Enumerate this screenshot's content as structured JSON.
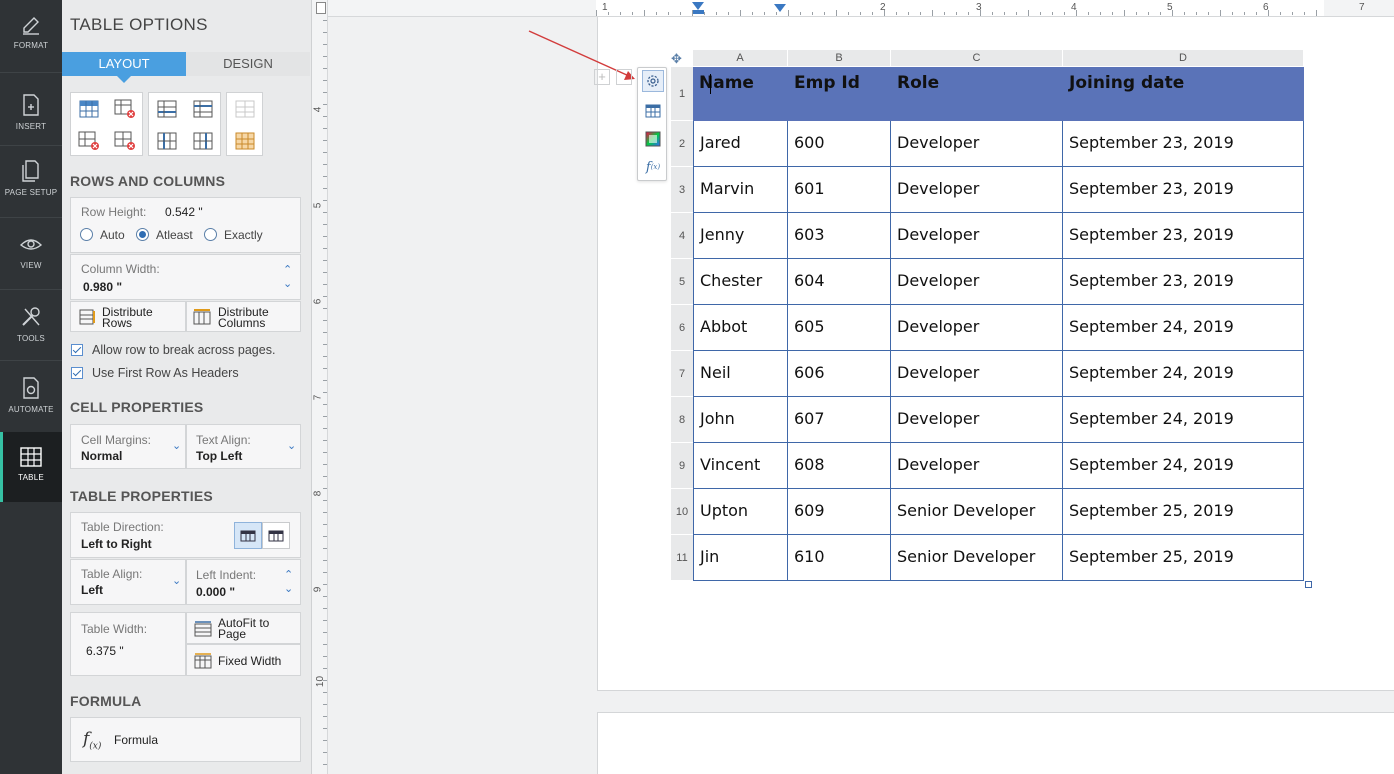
{
  "rail": {
    "items": [
      {
        "label": "FORMAT",
        "icon": "pen-icon"
      },
      {
        "label": "INSERT",
        "icon": "insert-doc-icon"
      },
      {
        "label": "PAGE SETUP",
        "icon": "page-setup-icon"
      },
      {
        "label": "VIEW",
        "icon": "eye-icon"
      },
      {
        "label": "TOOLS",
        "icon": "tools-icon"
      },
      {
        "label": "AUTOMATE",
        "icon": "automate-icon"
      },
      {
        "label": "TABLE",
        "icon": "table-icon",
        "active": true
      }
    ]
  },
  "panel": {
    "title": "TABLE OPTIONS",
    "tabs": {
      "layout": "LAYOUT",
      "design": "DESIGN"
    },
    "rows_columns": {
      "heading": "ROWS AND COLUMNS",
      "row_height_label": "Row Height:",
      "row_height_value": "0.542 \"",
      "radio_auto": "Auto",
      "radio_atleast": "Atleast",
      "radio_exactly": "Exactly",
      "selected_radio": "Atleast",
      "col_width_label": "Column Width:",
      "col_width_value": "0.980 \"",
      "distribute_rows": "Distribute Rows",
      "distribute_columns": "Distribute Columns",
      "allow_break": "Allow row to break across pages.",
      "first_row_headers": "Use First Row As Headers"
    },
    "cell_props": {
      "heading": "CELL PROPERTIES",
      "margins_label": "Cell Margins:",
      "margins_value": "Normal",
      "text_align_label": "Text Align:",
      "text_align_value": "Top Left"
    },
    "table_props": {
      "heading": "TABLE PROPERTIES",
      "direction_label": "Table Direction:",
      "direction_value": "Left to Right",
      "align_label": "Table Align:",
      "align_value": "Left",
      "indent_label": "Left Indent:",
      "indent_value": "0.000 \"",
      "width_label": "Table Width:",
      "width_value": "6.375 \"",
      "autofit": "AutoFit to Page",
      "fixed_width": "Fixed Width"
    },
    "formula": {
      "heading": "FORMULA",
      "button": "Formula"
    }
  },
  "ruler": {
    "h_numbers": [
      "1",
      "2",
      "3",
      "4",
      "5",
      "6",
      "7"
    ],
    "v_numbers": [
      "4",
      "5",
      "6",
      "7",
      "8",
      "9",
      "10"
    ]
  },
  "table": {
    "col_letters": [
      "A",
      "B",
      "C",
      "D"
    ],
    "header": [
      "Name",
      "Emp Id",
      "Role",
      "Joining date"
    ],
    "rows": [
      [
        "Jared",
        "600",
        "Developer",
        "September 23, 2019"
      ],
      [
        "Marvin",
        "601",
        "Developer",
        "September 23, 2019"
      ],
      [
        "Jenny",
        "603",
        "Developer",
        "September 23, 2019"
      ],
      [
        "Chester",
        "604",
        "Developer",
        "September 23, 2019"
      ],
      [
        "Abbot",
        "605",
        "Developer",
        "September 24, 2019"
      ],
      [
        "Neil",
        "606",
        "Developer",
        "September 24, 2019"
      ],
      [
        "John",
        "607",
        "Developer",
        "September 24, 2019"
      ],
      [
        "Vincent",
        "608",
        "Developer",
        "September 24, 2019"
      ],
      [
        "Upton",
        "609",
        "Senior Developer",
        "September 25, 2019"
      ],
      [
        "Jin",
        "610",
        "Senior Developer",
        "September 25, 2019"
      ]
    ],
    "row_numbers": [
      "1",
      "2",
      "3",
      "4",
      "5",
      "6",
      "7",
      "8",
      "9",
      "10",
      "11"
    ]
  },
  "colors": {
    "accent": "#4a9fe0",
    "header_fill": "#5a73b8",
    "border": "#3f67a8",
    "rail_active": "#36c1a4"
  }
}
